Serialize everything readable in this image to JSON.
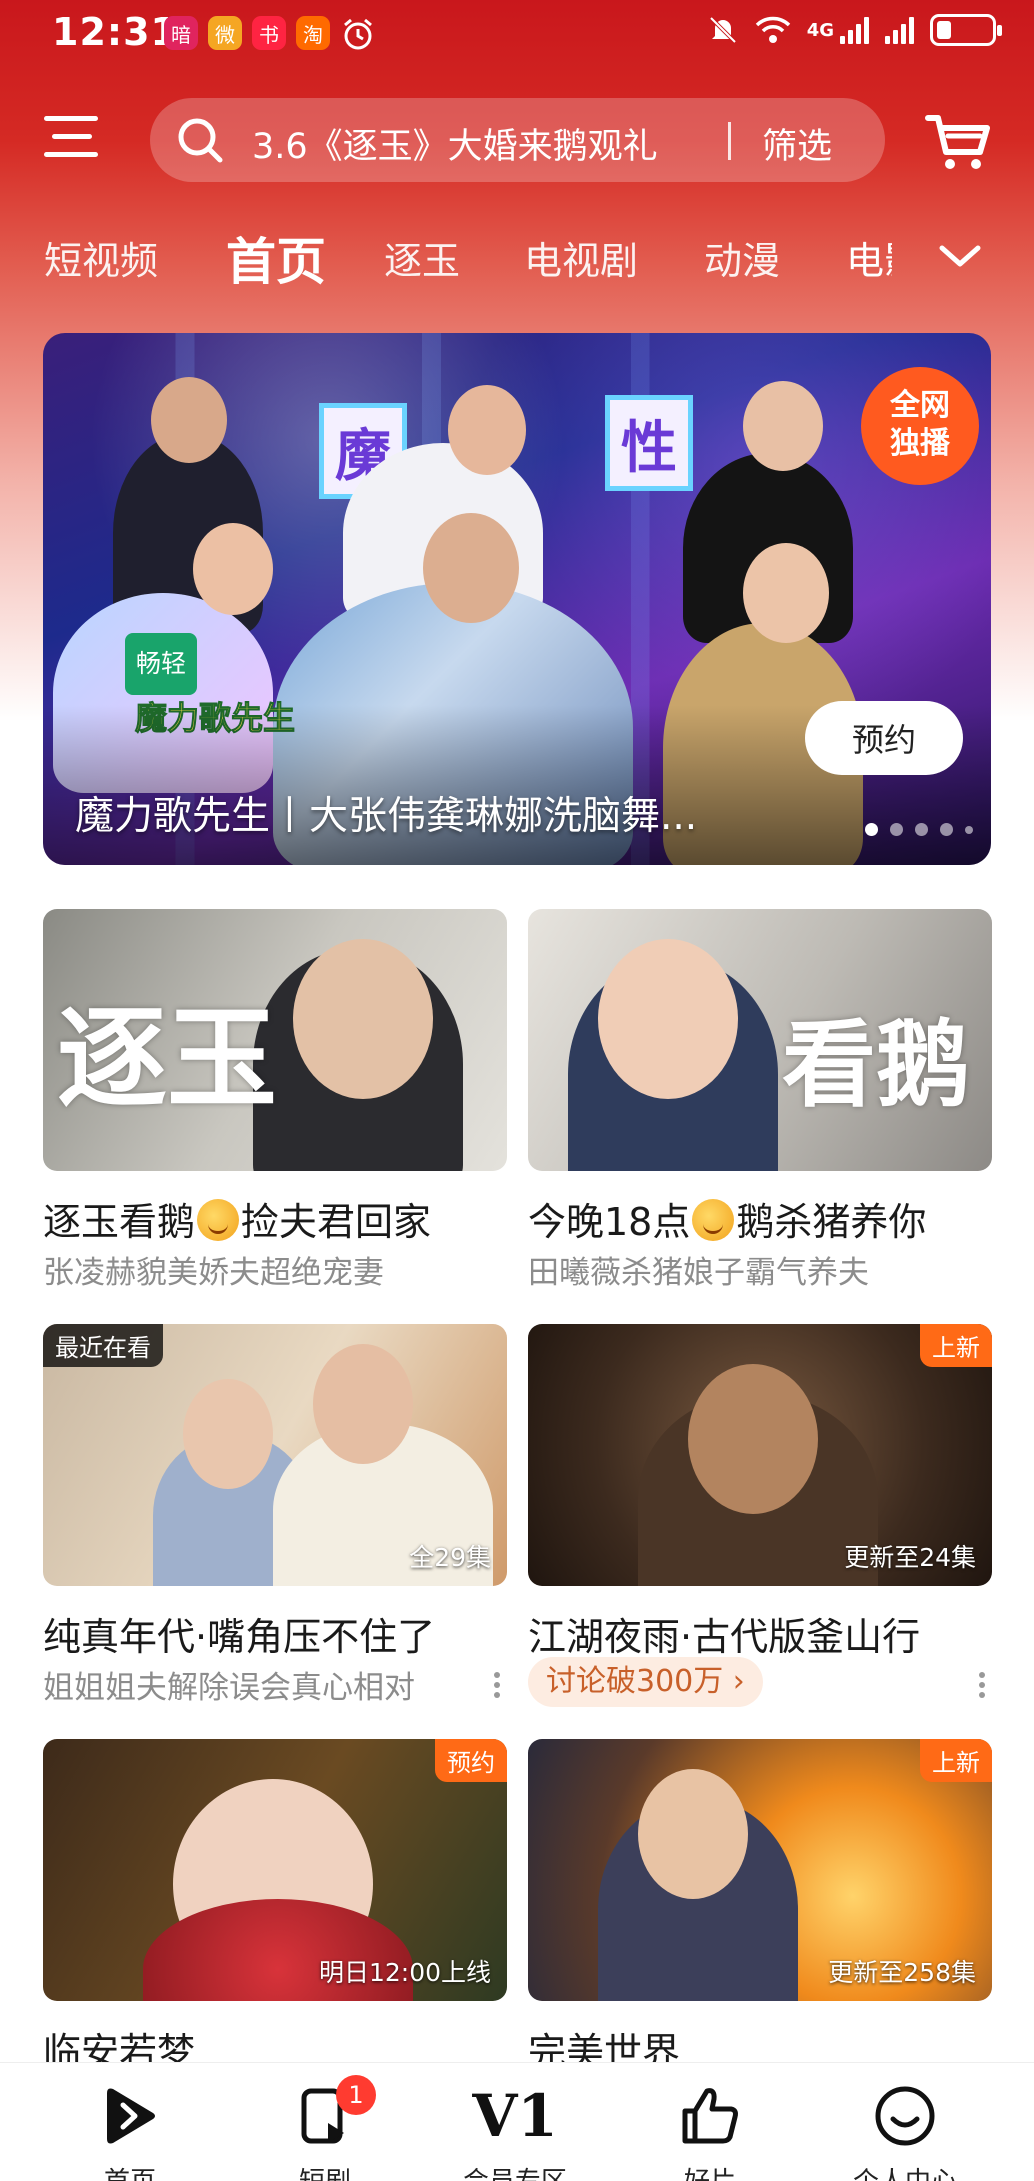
{
  "status_bar": {
    "time": "12:31",
    "network": "4G",
    "app_badges": [
      "暗",
      "微",
      "书",
      "淘"
    ]
  },
  "search": {
    "placeholder": "3.6《逐玉》大婚来鹅观礼",
    "filter_label": "筛选"
  },
  "tabs": [
    {
      "label": "短视频"
    },
    {
      "label": "首页",
      "active": true
    },
    {
      "label": "逐玉"
    },
    {
      "label": "电视剧"
    },
    {
      "label": "动漫"
    },
    {
      "label": "电影"
    }
  ],
  "banner": {
    "title": "魔力歌先生丨大张伟龚琳娜洗脑舞...",
    "reserve_label": "预约",
    "badge_line1": "全网",
    "badge_line2": "独播",
    "sign_left": "魔",
    "sign_right": "性",
    "logo_brand": "畅轻",
    "logo_show": "魔力歌先生",
    "page_count": 5,
    "current_page": 1
  },
  "cards": [
    {
      "title_a": "逐玉看鹅",
      "title_b": "捡夫君回家",
      "subtitle": "张凌赫貌美娇夫超绝宠妻",
      "overlay_text": "逐玉"
    },
    {
      "title_a": "今晚18点",
      "title_b": "鹅杀猪养你",
      "subtitle": "田曦薇杀猪娘子霸气养夫",
      "overlay_text": "看鹅"
    },
    {
      "title": "纯真年代·嘴角压不住了",
      "subtitle": "姐姐姐夫解除误会真心相对",
      "tag": "最近在看",
      "episode": "全29集"
    },
    {
      "title": "江湖夜雨·古代版釜山行",
      "pill": "讨论破300万 ›",
      "tag": "上新",
      "episode": "更新至24集"
    },
    {
      "title": "临安若梦",
      "tag": "预约",
      "episode": "明日12:00上线"
    },
    {
      "title": "完美世界",
      "tag": "上新",
      "episode": "更新至258集"
    }
  ],
  "bottom_nav": [
    {
      "label": "首页",
      "icon": "play-logo-icon",
      "active": true
    },
    {
      "label": "短剧",
      "icon": "short-drama-icon",
      "badge": "1"
    },
    {
      "label": "会员专区",
      "icon": "vip-icon",
      "glyph": "V1"
    },
    {
      "label": "好片",
      "icon": "thumbs-up-icon"
    },
    {
      "label": "个人中心",
      "icon": "smile-icon"
    }
  ]
}
